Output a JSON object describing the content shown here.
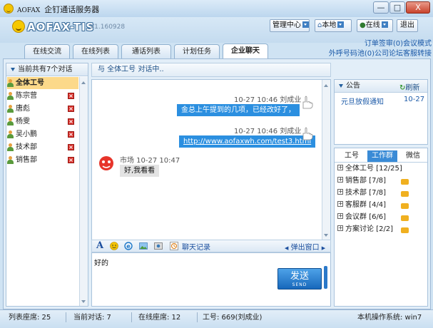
{
  "window": {
    "brand": "AOFAX",
    "title": "企钉通话服务器",
    "buttons": [
      "—",
      "□",
      "X"
    ]
  },
  "header": {
    "logo": "AOFAX-TIS",
    "version": "V1.160928",
    "buttons": [
      "管理中心",
      "本地",
      "在线",
      "退出"
    ],
    "links": {
      "line1": [
        "订单签审(0)",
        "会议模式"
      ],
      "line2": [
        "外呼号码池(0)",
        "公司论坛",
        "客服转接"
      ]
    }
  },
  "tabs": [
    "在线交流",
    "在线列表",
    "通话列表",
    "计划任务",
    "企业聊天"
  ],
  "left": {
    "header": "当前共有7个对话",
    "contacts": [
      "全体工号",
      "陈宗营",
      "唐彪",
      "杨雯",
      "吴小鹏",
      "技术部",
      "销售部"
    ]
  },
  "chat": {
    "header": "与 全体工号 对话中..",
    "messages": [
      {
        "meta": "10-27 10:46 刘成业",
        "text": "金总上午提到的几项，已经改好了，"
      },
      {
        "meta": "10-27 10:46 刘成业",
        "text": "http://www.aofaxwh.com/test3.html"
      },
      {
        "meta": "市场 10-27 10:47",
        "text": "好,我看看"
      }
    ],
    "toolbar": {
      "history": "聊天记录",
      "popup": "弹出窗口"
    },
    "input_value": "好的",
    "send": {
      "label": "发送",
      "sub": "SEND"
    }
  },
  "notice": {
    "header": "公告",
    "refresh": "刷新",
    "items": [
      {
        "title": "元旦放假通知",
        "date": "10-27"
      }
    ]
  },
  "groups": {
    "tabs": [
      "工号",
      "工作群",
      "微信"
    ],
    "items": [
      "全体工号 [12/25]",
      "销售部 [7/8]",
      "技术部 [7/8]",
      "客服群 [4/4]",
      "会议群 [6/6]",
      "方案讨论 [2/2]"
    ]
  },
  "status": {
    "seats": "列表座席: 25",
    "current": "当前对话: 7",
    "online": "在线座席: 12",
    "agent": "工号: 669(刘成业)",
    "os": "本机操作系统: win7"
  },
  "colors": {
    "accent": "#2b8fe0",
    "brand_blue": "#1c5aa8",
    "close": "#d8302a"
  }
}
